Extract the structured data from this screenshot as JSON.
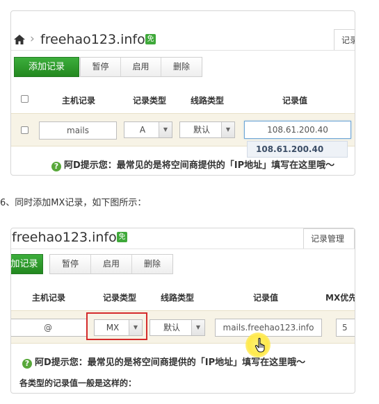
{
  "panel1": {
    "domain": "freehao123.info",
    "crumb_sep": "›",
    "free_badge": "免",
    "tab_label": "记录",
    "add_btn": "添加记录",
    "actions": [
      "暂停",
      "启用",
      "删除"
    ],
    "headers": [
      "主机记录",
      "记录类型",
      "线路类型",
      "记录值"
    ],
    "row": {
      "host": "mails",
      "type": "A",
      "line": "默认",
      "value": "108.61.200.40",
      "suggestion": "108.61.200.40"
    },
    "hint": "阿D提示您：最常见的是将空间商提供的「IP地址」填写在这里哦～"
  },
  "caption": "6、同时添加MX记录，如下图所示：",
  "panel2": {
    "domain": "freehao123.info",
    "free_badge": "免",
    "tab_label": "记录管理",
    "add_btn": "加记录",
    "actions": [
      "暂停",
      "启用",
      "删除"
    ],
    "headers": [
      "主机记录",
      "记录类型",
      "线路类型",
      "记录值",
      "MX优先"
    ],
    "row": {
      "host": "@",
      "type": "MX",
      "line": "默认",
      "value": "mails.freehao123.info",
      "priority": "5"
    },
    "hint": "阿D提示您：最常见的是将空间商提供的「IP地址」填写在这里哦～",
    "footer": "各类型的记录值一般是这样的："
  },
  "colors": {
    "green_button": "#2f9a2f",
    "row_highlight": "#f7f3e6",
    "red_box": "#d42b2b",
    "badge": "#3fa93a"
  },
  "icons": [
    "home-icon",
    "question-icon",
    "dropdown-arrow-icon",
    "hand-cursor-icon"
  ]
}
